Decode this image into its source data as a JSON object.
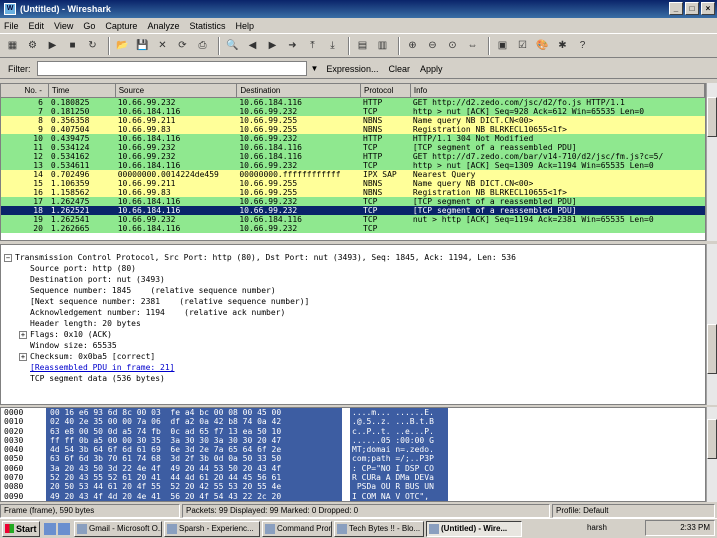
{
  "window": {
    "title": "(Untitled) - Wireshark"
  },
  "menu": [
    "File",
    "Edit",
    "View",
    "Go",
    "Capture",
    "Analyze",
    "Statistics",
    "Help"
  ],
  "toolbar_icons": [
    "interface-list-icon",
    "capture-options-icon",
    "start-capture-icon",
    "stop-capture-icon",
    "restart-capture-icon",
    "open-icon",
    "save-icon",
    "close-icon",
    "reload-icon",
    "print-icon",
    "find-icon",
    "back-icon",
    "forward-icon",
    "goto-icon",
    "first-icon",
    "last-icon",
    "colorize-icon",
    "autoscroll-icon",
    "zoom-in-icon",
    "zoom-out-icon",
    "zoom-normal-icon",
    "resize-columns-icon",
    "capture-filters-icon",
    "display-filters-icon",
    "coloring-rules-icon",
    "preferences-icon",
    "help-icon"
  ],
  "filter": {
    "label": "Filter:",
    "value": "",
    "expression": "Expression...",
    "clear": "Clear",
    "apply": "Apply"
  },
  "columns": [
    "No. -",
    "Time",
    "Source",
    "Destination",
    "Protocol",
    "Info"
  ],
  "rows": [
    {
      "no": "6",
      "time": "0.180825",
      "src": "10.66.99.232",
      "dst": "10.66.184.116",
      "proto": "HTTP",
      "info": "GET http://d2.zedo.com/jsc/d2/fo.js HTTP/1.1",
      "bg": "#8fe88f",
      "fg": "#000000"
    },
    {
      "no": "7",
      "time": "0.181250",
      "src": "10.66.184.116",
      "dst": "10.66.99.232",
      "proto": "TCP",
      "info": "http > nut [ACK] Seq=928 Ack=612 Win=65535 Len=0",
      "bg": "#8fe88f",
      "fg": "#000000"
    },
    {
      "no": "8",
      "time": "0.356358",
      "src": "10.66.99.211",
      "dst": "10.66.99.255",
      "proto": "NBNS",
      "info": "Name query NB DICT.CN<00>",
      "bg": "#ffff99",
      "fg": "#000000"
    },
    {
      "no": "9",
      "time": "0.407504",
      "src": "10.66.99.83",
      "dst": "10.66.99.255",
      "proto": "NBNS",
      "info": "Registration NB BLRKECL10655<1f>",
      "bg": "#ffff99",
      "fg": "#000000"
    },
    {
      "no": "10",
      "time": "0.439475",
      "time2": "",
      "src": "10.66.184.116",
      "dst": "10.66.99.232",
      "proto": "HTTP",
      "info": "HTTP/1.1 304 Not Modified",
      "bg": "#8fe88f",
      "fg": "#000000"
    },
    {
      "no": "11",
      "time": "0.534124",
      "src": "10.66.99.232",
      "dst": "10.66.184.116",
      "proto": "TCP",
      "info": "[TCP segment of a reassembled PDU]",
      "bg": "#8fe88f",
      "fg": "#000000"
    },
    {
      "no": "12",
      "time": "0.534162",
      "src": "10.66.99.232",
      "dst": "10.66.184.116",
      "proto": "HTTP",
      "info": "GET http://d7.zedo.com/bar/v14-710/d2/jsc/fm.js?c=5/",
      "bg": "#8fe88f",
      "fg": "#000000"
    },
    {
      "no": "13",
      "time": "0.534611",
      "src": "10.66.184.116",
      "dst": "10.66.99.232",
      "proto": "TCP",
      "info": "http > nut [ACK] Seq=1309 Ack=1194 Win=65535 Len=0",
      "bg": "#8fe88f",
      "fg": "#000000"
    },
    {
      "no": "14",
      "time": "0.702496",
      "src": "00000000.0014224de459",
      "dst": "00000000.ffffffffffff",
      "proto": "IPX SAP",
      "info": "Nearest Query",
      "bg": "#ffff99",
      "fg": "#000000"
    },
    {
      "no": "15",
      "time": "1.106359",
      "src": "10.66.99.211",
      "dst": "10.66.99.255",
      "proto": "NBNS",
      "info": "Name query NB DICT.CN<00>",
      "bg": "#ffff99",
      "fg": "#000000"
    },
    {
      "no": "16",
      "time": "1.158562",
      "src": "10.66.99.83",
      "dst": "10.66.99.255",
      "proto": "NBNS",
      "info": "Registration NB BLRKECL10655<1f>",
      "bg": "#ffff99",
      "fg": "#000000"
    },
    {
      "no": "17",
      "time": "1.262475",
      "src": "10.66.184.116",
      "dst": "10.66.99.232",
      "proto": "TCP",
      "info": "[TCP segment of a reassembled PDU]",
      "bg": "#8fe88f",
      "fg": "#000000"
    },
    {
      "no": "18",
      "time": "1.262521",
      "src": "10.66.184.116",
      "dst": "10.66.99.232",
      "proto": "TCP",
      "info": "[TCP segment of a reassembled PDU]",
      "bg": "#0a246a",
      "fg": "#ffffff"
    },
    {
      "no": "19",
      "time": "1.262541",
      "src": "10.66.99.232",
      "dst": "10.66.184.116",
      "proto": "TCP",
      "info": "nut > http [ACK] Seq=1194 Ack=2381 Win=65535 Len=0",
      "bg": "#8fe88f",
      "fg": "#000000"
    },
    {
      "no": "20",
      "time": "1.262665",
      "src": "10.66.184.116",
      "dst": "10.66.99.232",
      "proto": "TCP",
      "info": "",
      "bg": "#8fe88f",
      "fg": "#000000"
    }
  ],
  "details": [
    {
      "t": "Transmission Control Protocol, Src Port: http (80), Dst Port: nut (3493), Seq: 1845, Ack: 1194, Len: 536",
      "exp": "−",
      "indent": 0
    },
    {
      "t": "Source port: http (80)",
      "exp": "",
      "indent": 1
    },
    {
      "t": "Destination port: nut (3493)",
      "exp": "",
      "indent": 1
    },
    {
      "t": "Sequence number: 1845    (relative sequence number)",
      "exp": "",
      "indent": 1
    },
    {
      "t": "[Next sequence number: 2381    (relative sequence number)]",
      "exp": "",
      "indent": 1
    },
    {
      "t": "Acknowledgement number: 1194    (relative ack number)",
      "exp": "",
      "indent": 1
    },
    {
      "t": "Header length: 20 bytes",
      "exp": "",
      "indent": 1
    },
    {
      "t": "Flags: 0x10 (ACK)",
      "exp": "+",
      "indent": 1
    },
    {
      "t": "Window size: 65535",
      "exp": "",
      "indent": 1
    },
    {
      "t": "Checksum: 0x0ba5 [correct]",
      "exp": "+",
      "indent": 1
    },
    {
      "t": "[Reassembled PDU in frame: 21]",
      "exp": "",
      "indent": 1,
      "link": true
    },
    {
      "t": "TCP segment data (536 bytes)",
      "exp": "",
      "indent": 1
    }
  ],
  "hex": [
    {
      "off": "0000",
      "bytes": "00 16 e6 93 6d 8c 00 03  fe a4 bc 00 08 00 45 00",
      "ascii": "....m... ......E."
    },
    {
      "off": "0010",
      "bytes": "02 40 2e 35 00 00 7a 06  df a2 0a 42 b8 74 0a 42",
      "ascii": ".@.5..z. ...B.t.B"
    },
    {
      "off": "0020",
      "bytes": "63 e8 00 50 0d a5 74 fb  0c ad 65 f7 13 ea 50 10",
      "ascii": "c..P..t. ..e...P."
    },
    {
      "off": "0030",
      "bytes": "ff ff 0b a5 00 00 30 35  3a 30 30 3a 30 30 20 47",
      "ascii": "......05 :00:00 G"
    },
    {
      "off": "0040",
      "bytes": "4d 54 3b 64 6f 6d 61 69  6e 3d 2e 7a 65 64 6f 2e",
      "ascii": "MT;domai n=.zedo."
    },
    {
      "off": "0050",
      "bytes": "63 6f 6d 3b 70 61 74 68  3d 2f 3b 0d 0a 50 33 50",
      "ascii": "com;path =/;..P3P"
    },
    {
      "off": "0060",
      "bytes": "3a 20 43 50 3d 22 4e 4f  49 20 44 53 50 20 43 4f",
      "ascii": ": CP=\"NO I DSP CO"
    },
    {
      "off": "0070",
      "bytes": "52 20 43 55 52 61 20 41  44 4d 61 20 44 45 56 61",
      "ascii": "R CURa A DMa DEVa"
    },
    {
      "off": "0080",
      "bytes": "20 50 53 44 61 20 4f 55  52 20 42 55 53 20 55 4e",
      "ascii": " PSDa OU R BUS UN"
    },
    {
      "off": "0090",
      "bytes": "49 20 43 4f 4d 20 4e 41  56 20 4f 54 43 22 2c 20",
      "ascii": "I COM NA V OTC\", "
    }
  ],
  "status": {
    "frame": "Frame (frame), 590 bytes",
    "packets": "Packets: 99 Displayed: 99 Marked: 0 Dropped: 0",
    "profile": "Profile: Default"
  },
  "taskbar": {
    "start": "Start",
    "tasks": [
      "Gmail - Microsoft O...",
      "Sparsh - Experienc...",
      "Command Prompt",
      "Tech Bytes !! - Blo...",
      "(Untitled) - Wire..."
    ],
    "user": "harsh",
    "clock": "2:33 PM"
  }
}
